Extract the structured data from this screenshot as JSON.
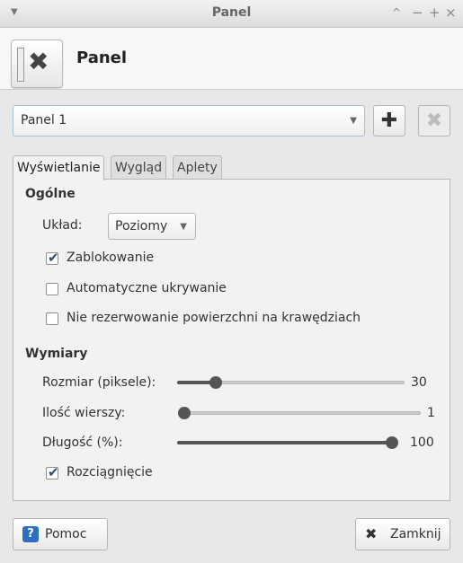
{
  "window": {
    "title": "Panel",
    "menu_icon": "chevron-down-icon",
    "controls": [
      "^",
      "−",
      "+",
      "×"
    ]
  },
  "header": {
    "title": "Panel",
    "icon": "panel-preferences-icon"
  },
  "panel_select": {
    "value": "Panel 1",
    "add_icon": "plus-icon",
    "remove_icon": "remove-icon"
  },
  "tabs": [
    {
      "label": "Wyświetlanie",
      "active": true
    },
    {
      "label": "Wygląd",
      "active": false
    },
    {
      "label": "Aplety",
      "active": false
    }
  ],
  "general": {
    "heading": "Ogólne",
    "layout_label": "Układ:",
    "layout_value": "Poziomy",
    "lock_label": "Zablokowanie",
    "lock_checked": true,
    "autohide_label": "Automatyczne ukrywanie",
    "autohide_checked": false,
    "reserve_label": "Nie rezerwowanie powierzchni na krawędziach",
    "reserve_checked": false
  },
  "dimensions": {
    "heading": "Wymiary",
    "size_label": "Rozmiar (piksele):",
    "size_value": "30",
    "size_fraction": 0.15,
    "rows_label": "Ilość wierszy:",
    "rows_value": "1",
    "rows_fraction": 0.0,
    "length_label": "Długość (%):",
    "length_value": "100",
    "length_fraction": 1.0,
    "stretch_label": "Rozciągnięcie",
    "stretch_checked": true
  },
  "footer": {
    "help_label": "Pomoc",
    "help_icon": "help-icon",
    "close_label": "Zamknij",
    "close_icon": "close-icon"
  },
  "colors": {
    "accent": "#2f6fc1",
    "check": "#2d4c7c",
    "slider": "#555555"
  }
}
